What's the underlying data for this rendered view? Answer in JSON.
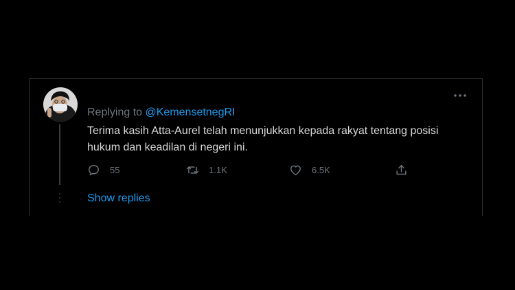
{
  "tweet": {
    "replying_prefix": "Replying to ",
    "replying_handle": "@KemensetnegRI",
    "text": "Terima kasih Atta-Aurel telah menunjukkan kepada rakyat tentang posisi hukum dan keadilan di negeri ini.",
    "actions": {
      "reply_count": "55",
      "retweet_count": "1.1K",
      "like_count": "6.5K"
    },
    "show_replies_label": "Show replies"
  },
  "icons": {
    "more": "more-horizontal-icon",
    "reply": "reply-icon",
    "retweet": "retweet-icon",
    "like": "heart-icon",
    "share": "share-icon"
  },
  "colors": {
    "background": "#000000",
    "text": "#d9d9d9",
    "muted": "#6e767d",
    "accent": "#1d9bf0",
    "border": "#2f3336"
  }
}
